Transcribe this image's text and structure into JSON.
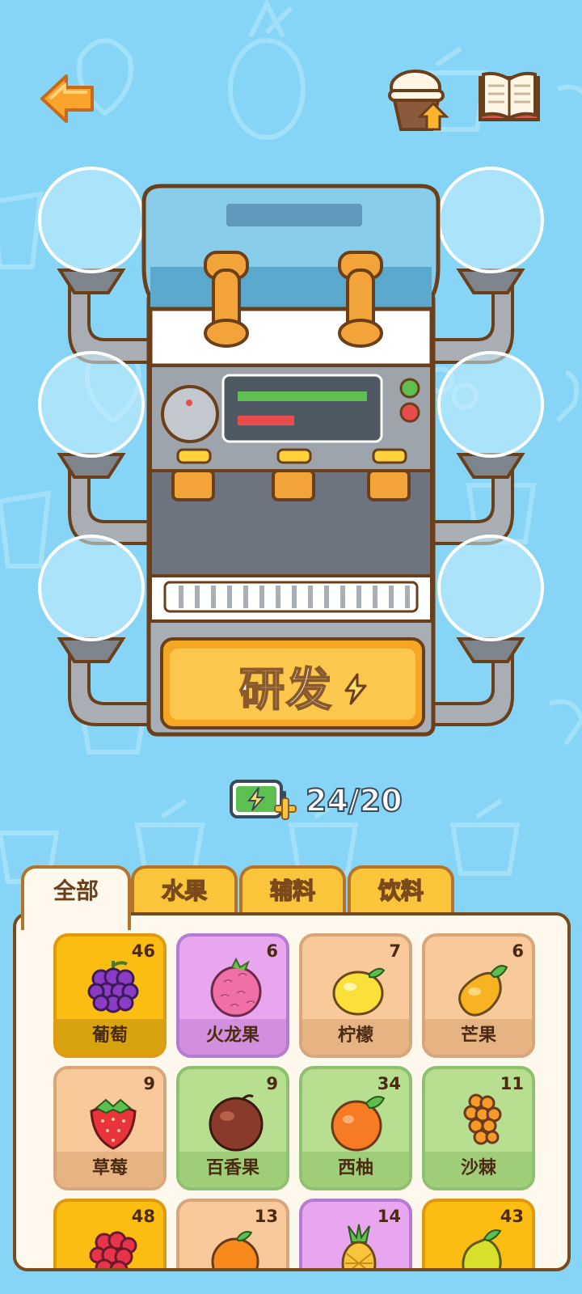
{
  "energy": {
    "value": "24/20"
  },
  "research_button": {
    "label": "研发"
  },
  "tabs": [
    {
      "label": "全部",
      "active": true
    },
    {
      "label": "水果",
      "active": false
    },
    {
      "label": "辅料",
      "active": false
    },
    {
      "label": "饮料",
      "active": false
    }
  ],
  "items": [
    {
      "name": "葡萄",
      "count": "46",
      "icon": "grape-icon",
      "color": "gold"
    },
    {
      "name": "火龙果",
      "count": "6",
      "icon": "dragonfruit-icon",
      "color": "purple"
    },
    {
      "name": "柠檬",
      "count": "7",
      "icon": "lemon-icon",
      "color": "peach"
    },
    {
      "name": "芒果",
      "count": "6",
      "icon": "mango-icon",
      "color": "peach"
    },
    {
      "name": "草莓",
      "count": "9",
      "icon": "strawberry-icon",
      "color": "peach"
    },
    {
      "name": "百香果",
      "count": "9",
      "icon": "passionfruit-icon",
      "color": "green"
    },
    {
      "name": "西柚",
      "count": "34",
      "icon": "grapefruit-icon",
      "color": "green"
    },
    {
      "name": "沙棘",
      "count": "11",
      "icon": "seabuckthorn-icon",
      "color": "green"
    },
    {
      "name": "",
      "count": "48",
      "icon": "raspberry-icon",
      "color": "gold"
    },
    {
      "name": "",
      "count": "13",
      "icon": "orange-icon",
      "color": "peach"
    },
    {
      "name": "",
      "count": "14",
      "icon": "pineapple-icon",
      "color": "purple"
    },
    {
      "name": "",
      "count": "43",
      "icon": "pear-icon",
      "color": "gold"
    }
  ],
  "icons": {
    "back": "back-arrow-icon",
    "upgrade": "cup-upgrade-icon",
    "book": "recipe-book-icon",
    "energy": "battery-icon"
  },
  "colors": {
    "background": "#86d5f6",
    "accent": "#fbc53b",
    "outline": "#7a4a1a"
  }
}
